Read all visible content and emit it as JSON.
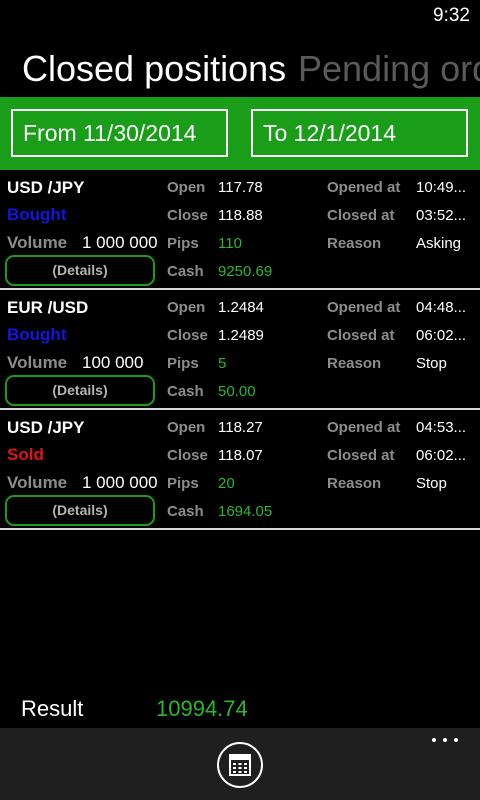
{
  "status": {
    "time": "9:32"
  },
  "pivot": {
    "active": "Closed positions",
    "next": "Pending ord"
  },
  "filters": {
    "from": "From 11/30/2014",
    "to": "To 12/1/2014"
  },
  "labels": {
    "volume": "Volume",
    "details": "(Details)",
    "open": "Open",
    "close": "Close",
    "pips": "Pips",
    "cash": "Cash",
    "opened_at": "Opened at",
    "closed_at": "Closed at",
    "reason": "Reason"
  },
  "positions": [
    {
      "pair": "USD /JPY",
      "side": "Bought",
      "volume": "1 000 000",
      "open": "117.78",
      "close": "118.88",
      "pips": "110",
      "cash": "9250.69",
      "opened_at": "10:49...",
      "closed_at": "03:52...",
      "reason": "Asking"
    },
    {
      "pair": "EUR /USD",
      "side": "Bought",
      "volume": "100 000",
      "open": "1.2484",
      "close": "1.2489",
      "pips": "5",
      "cash": "50.00",
      "opened_at": "04:48...",
      "closed_at": "06:02...",
      "reason": "Stop"
    },
    {
      "pair": "USD /JPY",
      "side": "Sold",
      "volume": "1 000 000",
      "open": "118.27",
      "close": "118.07",
      "pips": "20",
      "cash": "1694.05",
      "opened_at": "04:53...",
      "closed_at": "06:02...",
      "reason": "Stop"
    }
  ],
  "summary": {
    "label": "Result",
    "value": "10994.74"
  },
  "appbar": {
    "primary_icon": "calendar-icon",
    "more_icon": "ellipsis-icon"
  },
  "colors": {
    "accent_green": "#1a9e1a",
    "value_green": "#2bb82b",
    "bought_blue": "#1414e0",
    "sold_red": "#e01414"
  }
}
